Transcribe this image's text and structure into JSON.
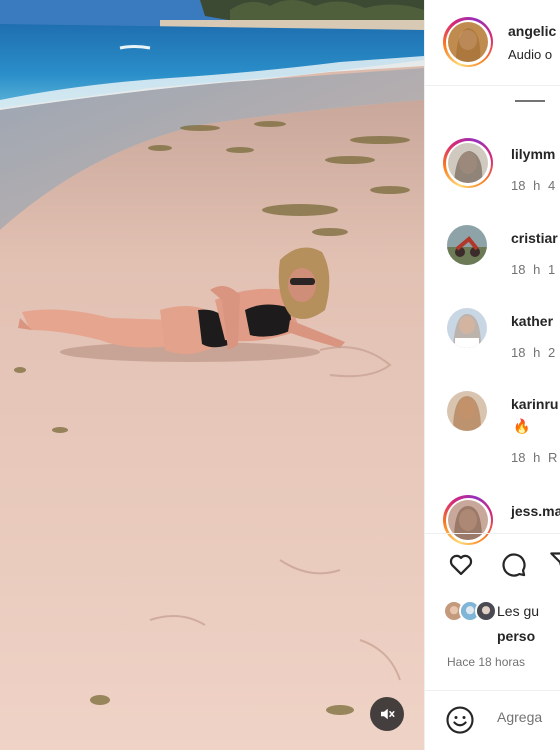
{
  "post": {
    "username": "angelic",
    "audio": "Audio o"
  },
  "comments": [
    {
      "username": "lilymm",
      "time": "18 h",
      "extra": "4",
      "emoji": ""
    },
    {
      "username": "cristiar",
      "time": "18 h",
      "extra": "1",
      "emoji": ""
    },
    {
      "username": "kather",
      "time": "18 h",
      "extra": "2",
      "emoji": ""
    },
    {
      "username": "karinru",
      "time": "18 h",
      "extra": "R",
      "emoji": "🔥"
    },
    {
      "username": "jess.ma",
      "time": "",
      "extra": "",
      "emoji": ""
    }
  ],
  "likes": {
    "text": "Les gu",
    "bold": "perso"
  },
  "timestamp": "Hace 18 horas",
  "add_comment": {
    "placeholder": "Agrega"
  },
  "icons": {
    "like": "heart-icon",
    "comment": "comment-icon",
    "share": "paper-plane-icon",
    "mute": "speaker-muted-icon",
    "emoji": "smiley-icon"
  },
  "colors": {
    "story_ring": "#d62976",
    "text": "#262626",
    "muted": "#737373"
  }
}
